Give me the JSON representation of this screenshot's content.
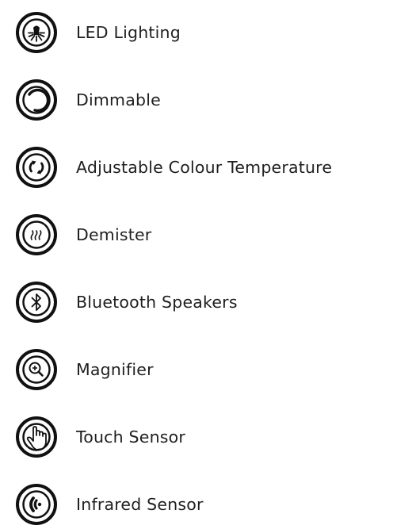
{
  "features": [
    {
      "icon": "led-bulb-icon",
      "label": "LED Lighting"
    },
    {
      "icon": "dimmer-dial-icon",
      "label": "Dimmable"
    },
    {
      "icon": "colour-cycle-icon",
      "label": "Adjustable Colour Temperature"
    },
    {
      "icon": "heat-waves-icon",
      "label": "Demister"
    },
    {
      "icon": "bluetooth-icon",
      "label": "Bluetooth Speakers"
    },
    {
      "icon": "magnifier-icon",
      "label": "Magnifier"
    },
    {
      "icon": "hand-touch-icon",
      "label": "Touch Sensor"
    },
    {
      "icon": "infrared-signal-icon",
      "label": "Infrared Sensor"
    }
  ],
  "colors": {
    "icon": "#111111",
    "text": "#1f1f1f",
    "background": "#ffffff"
  }
}
